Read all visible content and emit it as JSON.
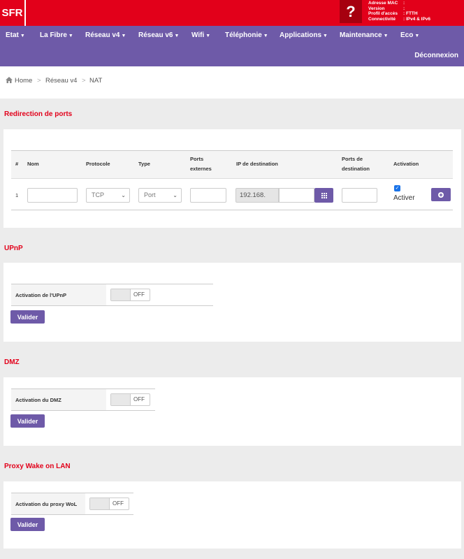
{
  "header": {
    "logo": "SFR",
    "help": "?",
    "info": [
      {
        "label": "Adresse MAC",
        "value": ":"
      },
      {
        "label": "Version",
        "value": ":"
      },
      {
        "label": "Profil d'accès",
        "value": ": FTTH"
      },
      {
        "label": "Connectivité",
        "value": ": IPv4 & IPv6"
      }
    ],
    "colors": {
      "brand_red": "#e2001a",
      "nav_purple": "#6e5aa8"
    }
  },
  "nav": {
    "items": [
      "Etat",
      "La Fibre",
      "Réseau v4",
      "Réseau v6",
      "Wifi",
      "Téléphonie",
      "Applications",
      "Maintenance",
      "Eco"
    ],
    "logout": "Déconnexion"
  },
  "breadcrumb": [
    "Home",
    "Réseau v4",
    "NAT"
  ],
  "port_forwarding": {
    "title": "Redirection de ports",
    "columns": {
      "num": "#",
      "name": "Nom",
      "protocol": "Protocole",
      "type": "Type",
      "ext_ports_1": "Ports",
      "ext_ports_2": "externes",
      "dest_ip": "IP de destination",
      "dest_ports_1": "Ports de",
      "dest_ports_2": "destination",
      "activation": "Activation"
    },
    "row": {
      "num": "1",
      "name": "",
      "protocol": "TCP",
      "type": "Port",
      "ip_prefix": "192.168.",
      "activate_label": "Activer",
      "activated": true
    }
  },
  "upnp": {
    "title": "UPnP",
    "label": "Activation de l'UPnP",
    "state": "OFF",
    "submit": "Valider"
  },
  "dmz": {
    "title": "DMZ",
    "label": "Activation du DMZ",
    "state": "OFF",
    "submit": "Valider"
  },
  "wol": {
    "title": "Proxy Wake on LAN",
    "label": "Activation du proxy WoL",
    "state": "OFF",
    "submit": "Valider"
  }
}
